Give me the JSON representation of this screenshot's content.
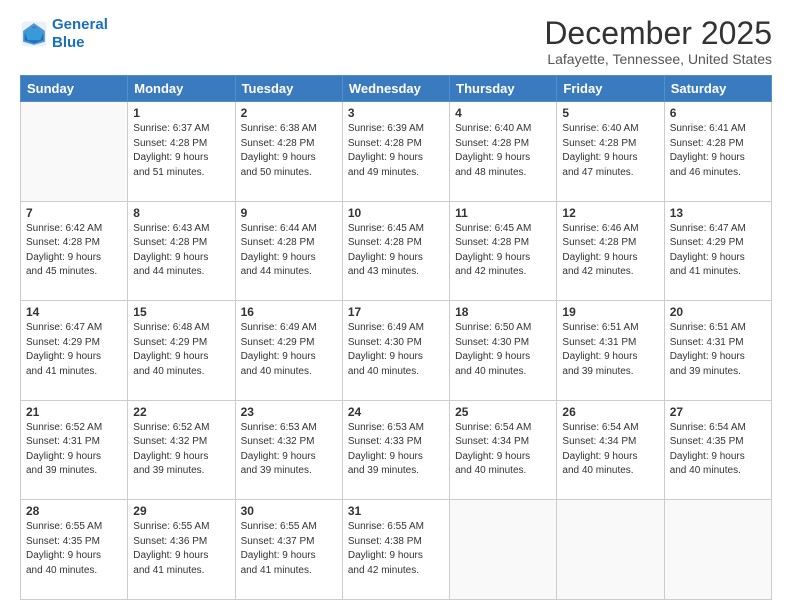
{
  "logo": {
    "line1": "General",
    "line2": "Blue"
  },
  "title": "December 2025",
  "subtitle": "Lafayette, Tennessee, United States",
  "days_header": [
    "Sunday",
    "Monday",
    "Tuesday",
    "Wednesday",
    "Thursday",
    "Friday",
    "Saturday"
  ],
  "weeks": [
    [
      {
        "day": "",
        "info": ""
      },
      {
        "day": "1",
        "info": "Sunrise: 6:37 AM\nSunset: 4:28 PM\nDaylight: 9 hours\nand 51 minutes."
      },
      {
        "day": "2",
        "info": "Sunrise: 6:38 AM\nSunset: 4:28 PM\nDaylight: 9 hours\nand 50 minutes."
      },
      {
        "day": "3",
        "info": "Sunrise: 6:39 AM\nSunset: 4:28 PM\nDaylight: 9 hours\nand 49 minutes."
      },
      {
        "day": "4",
        "info": "Sunrise: 6:40 AM\nSunset: 4:28 PM\nDaylight: 9 hours\nand 48 minutes."
      },
      {
        "day": "5",
        "info": "Sunrise: 6:40 AM\nSunset: 4:28 PM\nDaylight: 9 hours\nand 47 minutes."
      },
      {
        "day": "6",
        "info": "Sunrise: 6:41 AM\nSunset: 4:28 PM\nDaylight: 9 hours\nand 46 minutes."
      }
    ],
    [
      {
        "day": "7",
        "info": "Sunrise: 6:42 AM\nSunset: 4:28 PM\nDaylight: 9 hours\nand 45 minutes."
      },
      {
        "day": "8",
        "info": "Sunrise: 6:43 AM\nSunset: 4:28 PM\nDaylight: 9 hours\nand 44 minutes."
      },
      {
        "day": "9",
        "info": "Sunrise: 6:44 AM\nSunset: 4:28 PM\nDaylight: 9 hours\nand 44 minutes."
      },
      {
        "day": "10",
        "info": "Sunrise: 6:45 AM\nSunset: 4:28 PM\nDaylight: 9 hours\nand 43 minutes."
      },
      {
        "day": "11",
        "info": "Sunrise: 6:45 AM\nSunset: 4:28 PM\nDaylight: 9 hours\nand 42 minutes."
      },
      {
        "day": "12",
        "info": "Sunrise: 6:46 AM\nSunset: 4:28 PM\nDaylight: 9 hours\nand 42 minutes."
      },
      {
        "day": "13",
        "info": "Sunrise: 6:47 AM\nSunset: 4:29 PM\nDaylight: 9 hours\nand 41 minutes."
      }
    ],
    [
      {
        "day": "14",
        "info": "Sunrise: 6:47 AM\nSunset: 4:29 PM\nDaylight: 9 hours\nand 41 minutes."
      },
      {
        "day": "15",
        "info": "Sunrise: 6:48 AM\nSunset: 4:29 PM\nDaylight: 9 hours\nand 40 minutes."
      },
      {
        "day": "16",
        "info": "Sunrise: 6:49 AM\nSunset: 4:29 PM\nDaylight: 9 hours\nand 40 minutes."
      },
      {
        "day": "17",
        "info": "Sunrise: 6:49 AM\nSunset: 4:30 PM\nDaylight: 9 hours\nand 40 minutes."
      },
      {
        "day": "18",
        "info": "Sunrise: 6:50 AM\nSunset: 4:30 PM\nDaylight: 9 hours\nand 40 minutes."
      },
      {
        "day": "19",
        "info": "Sunrise: 6:51 AM\nSunset: 4:31 PM\nDaylight: 9 hours\nand 39 minutes."
      },
      {
        "day": "20",
        "info": "Sunrise: 6:51 AM\nSunset: 4:31 PM\nDaylight: 9 hours\nand 39 minutes."
      }
    ],
    [
      {
        "day": "21",
        "info": "Sunrise: 6:52 AM\nSunset: 4:31 PM\nDaylight: 9 hours\nand 39 minutes."
      },
      {
        "day": "22",
        "info": "Sunrise: 6:52 AM\nSunset: 4:32 PM\nDaylight: 9 hours\nand 39 minutes."
      },
      {
        "day": "23",
        "info": "Sunrise: 6:53 AM\nSunset: 4:32 PM\nDaylight: 9 hours\nand 39 minutes."
      },
      {
        "day": "24",
        "info": "Sunrise: 6:53 AM\nSunset: 4:33 PM\nDaylight: 9 hours\nand 39 minutes."
      },
      {
        "day": "25",
        "info": "Sunrise: 6:54 AM\nSunset: 4:34 PM\nDaylight: 9 hours\nand 40 minutes."
      },
      {
        "day": "26",
        "info": "Sunrise: 6:54 AM\nSunset: 4:34 PM\nDaylight: 9 hours\nand 40 minutes."
      },
      {
        "day": "27",
        "info": "Sunrise: 6:54 AM\nSunset: 4:35 PM\nDaylight: 9 hours\nand 40 minutes."
      }
    ],
    [
      {
        "day": "28",
        "info": "Sunrise: 6:55 AM\nSunset: 4:35 PM\nDaylight: 9 hours\nand 40 minutes."
      },
      {
        "day": "29",
        "info": "Sunrise: 6:55 AM\nSunset: 4:36 PM\nDaylight: 9 hours\nand 41 minutes."
      },
      {
        "day": "30",
        "info": "Sunrise: 6:55 AM\nSunset: 4:37 PM\nDaylight: 9 hours\nand 41 minutes."
      },
      {
        "day": "31",
        "info": "Sunrise: 6:55 AM\nSunset: 4:38 PM\nDaylight: 9 hours\nand 42 minutes."
      },
      {
        "day": "",
        "info": ""
      },
      {
        "day": "",
        "info": ""
      },
      {
        "day": "",
        "info": ""
      }
    ]
  ]
}
